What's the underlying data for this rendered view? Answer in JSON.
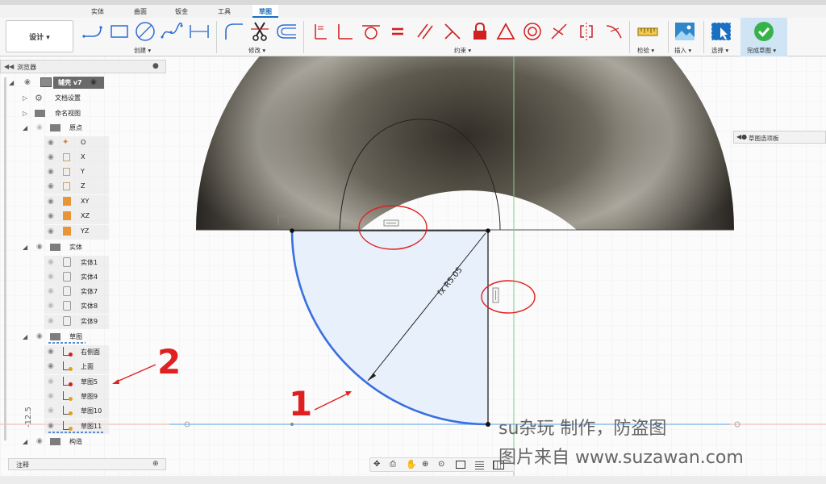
{
  "toolbar": {
    "workspace_label": "设计 ▾",
    "tabs": [
      "实体",
      "曲面",
      "钣金",
      "工具",
      "草图"
    ],
    "groups": {
      "create": "创建 ▾",
      "modify": "修改 ▾",
      "constraints": "约束 ▾",
      "inspect": "检验 ▾",
      "insert": "插入 ▾",
      "select": "选择 ▾",
      "finish": "完成草图 ▾"
    }
  },
  "browser": {
    "title": "浏览器",
    "root_label": "辅壳 v7",
    "items": [
      "文档设置",
      "命名视图",
      "原点",
      "O",
      "X",
      "Y",
      "Z",
      "XY",
      "XZ",
      "YZ",
      "实体",
      "实体1",
      "实体4",
      "实体7",
      "实体8",
      "实体9",
      "草图",
      "右侧面",
      "上面",
      "草图5",
      "草图9",
      "草图10",
      "草图11",
      "构造"
    ]
  },
  "notes_label": "注释",
  "sketch_palette_label": "草图选项板",
  "sketch": {
    "dimension_label": "fx R5.05",
    "axis_value": "-12.5"
  },
  "annotations": [
    "1",
    "2"
  ],
  "watermark": {
    "line1": "su杂玩 制作，防盗图",
    "line2": "图片来自 www.suzawan.com"
  },
  "colors": {
    "accent": "#1a6fc0",
    "annotation_red": "#e02020",
    "sketch_arc": "#3a6fe0",
    "profile_fill": "#e4effa",
    "finish_check": "#35b34a"
  }
}
